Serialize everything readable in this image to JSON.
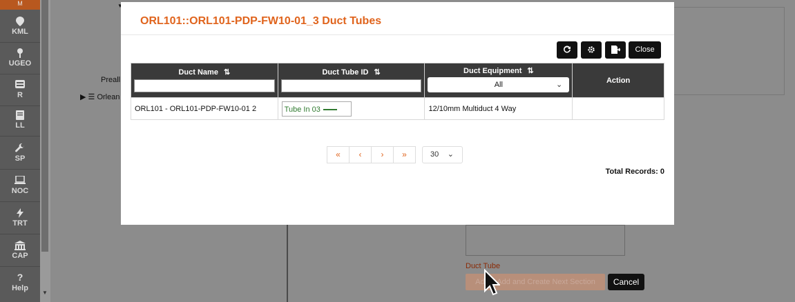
{
  "sidebar": {
    "top_label": "M",
    "items": [
      {
        "icon": "map-pin-icon",
        "label": "KML"
      },
      {
        "icon": "pin-icon",
        "label": "UGEO"
      },
      {
        "icon": "card-icon",
        "label": "R"
      },
      {
        "icon": "book-icon",
        "label": "LL"
      },
      {
        "icon": "wrench-icon",
        "label": "SP"
      },
      {
        "icon": "laptop-icon",
        "label": "NOC"
      },
      {
        "icon": "lightning-icon",
        "label": "TRT"
      },
      {
        "icon": "building-icon",
        "label": "CAP"
      },
      {
        "icon": "question-icon",
        "label": "Help"
      }
    ]
  },
  "background": {
    "tree_item_1": "Preall",
    "tree_item_2": "Orlean",
    "duct_tube_label": "Duct Tube",
    "add_button": "Add... Add and Create Next Section",
    "cancel_button": "Cancel"
  },
  "modal": {
    "title": "ORL101::ORL101-PDP-FW10-01_3 Duct Tubes",
    "toolbar": {
      "refresh_icon": "refresh-icon",
      "settings_icon": "gear-icon",
      "export_icon": "export-icon",
      "close_label": "Close"
    },
    "columns": {
      "duct_name": "Duct Name",
      "duct_tube_id": "Duct Tube ID",
      "duct_equipment": "Duct Equipment",
      "action": "Action"
    },
    "filters": {
      "equipment_selected": "All"
    },
    "rows": [
      {
        "duct_name": "ORL101 - ORL101-PDP-FW10-01 2",
        "duct_tube_id": "Tube In 03",
        "duct_equipment": "12/10mm Multiduct 4 Way",
        "action": ""
      }
    ],
    "pager": {
      "first": "«",
      "prev": "‹",
      "next": "›",
      "last": "»",
      "page_size": "30"
    },
    "total_records": "Total Records: 0"
  },
  "colors": {
    "accent": "#e0641d",
    "header_bg": "#3a3a3a",
    "sidebar_bg": "#5a5a5a",
    "tube_text": "#2f7a2f"
  }
}
